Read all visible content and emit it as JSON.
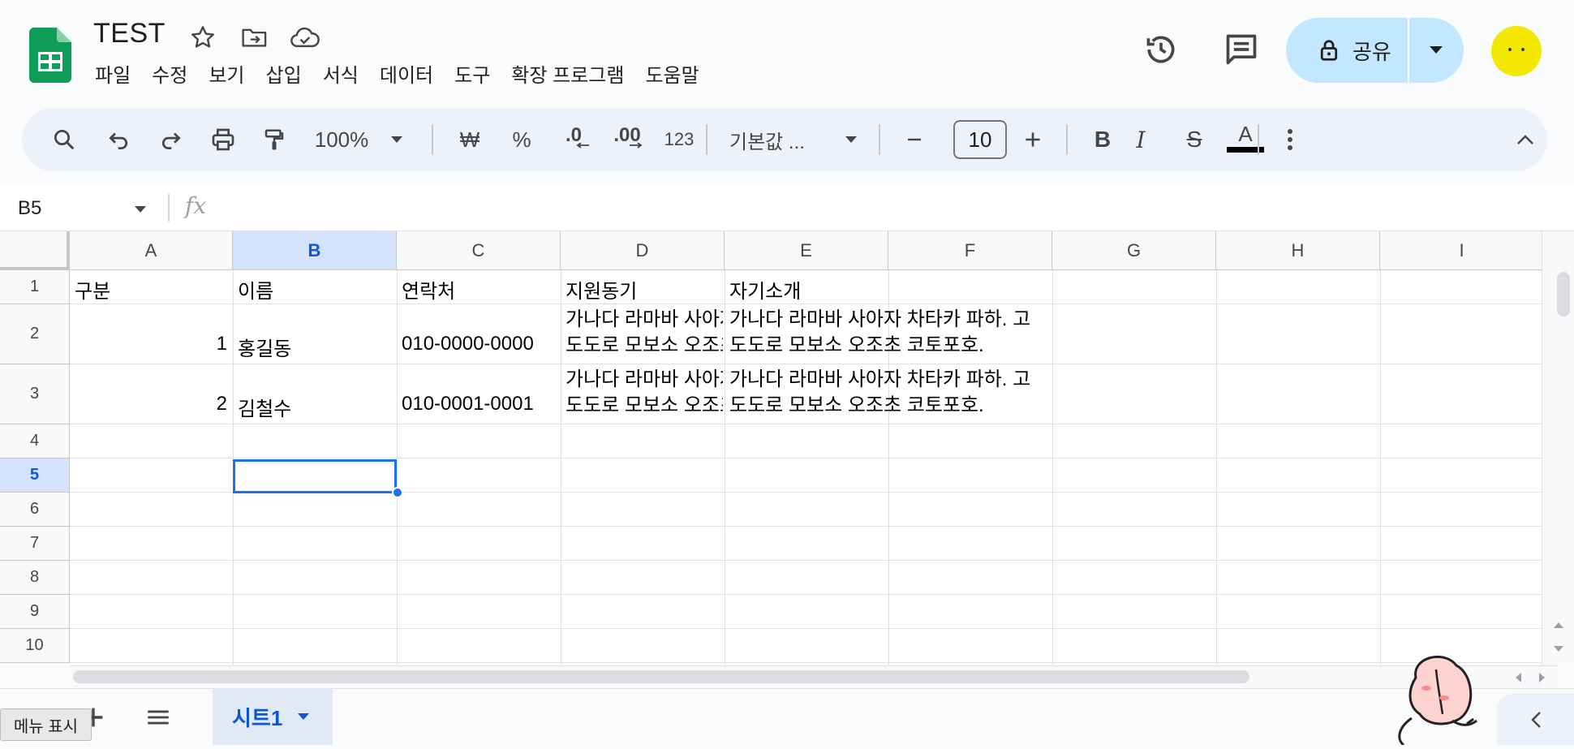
{
  "header": {
    "doc_title": "TEST",
    "menus": [
      "파일",
      "수정",
      "보기",
      "삽입",
      "서식",
      "데이터",
      "도구",
      "확장 프로그램",
      "도움말"
    ],
    "share_label": "공유"
  },
  "toolbar": {
    "zoom": "100%",
    "currency_symbol": "₩",
    "percent_symbol": "%",
    "decrease_decimal": ".0",
    "increase_decimal": ".00",
    "more_formats": "123",
    "font_name": "기본값 ...",
    "font_size": "10",
    "bold": "B",
    "italic": "I",
    "strike": "S",
    "text_color": "A"
  },
  "formula_bar": {
    "name_box": "B5",
    "fx": "fx"
  },
  "grid": {
    "columns": [
      "A",
      "B",
      "C",
      "D",
      "E",
      "F",
      "G",
      "H",
      "I"
    ],
    "selected_column": "B",
    "rows": [
      "1",
      "2",
      "3",
      "4",
      "5",
      "6",
      "7",
      "8",
      "9",
      "10"
    ],
    "selected_row": "5",
    "cells": {
      "A1": "구분",
      "B1": "이름",
      "C1": "연락처",
      "D1": "지원동기",
      "E1": "자기소개",
      "A2": "1",
      "B2": "홍길동",
      "C2": "010-0000-0000",
      "D2": "가나다 라마바 사아자 차타카 파하. 고도도로 모보소 오조초 코토포호.",
      "E2": "가나다 라마바 사아자 차타카 파하. 고도도로 모보소 오조초 코토포호.",
      "A3": "2",
      "B3": "김철수",
      "C3": "010-0001-0001",
      "D3": "가나다 라마바 사아자 차타카 파하. 고도도로 모보소 오조초 코토포호.",
      "E3": "가나다 라마바 사아자 차타카 파하. 고도도로 모보소 오조초 코토포호."
    }
  },
  "sheets": {
    "active": "시트1",
    "tooltip": "메뉴 표시"
  },
  "colors": {
    "accent": "#0b57d0",
    "share_bg": "#c2e7ff",
    "toolbar_bg": "#edf2fa",
    "selection": "#1a73e8",
    "avatar": "#f5e800",
    "logo": "#0f9d58"
  }
}
